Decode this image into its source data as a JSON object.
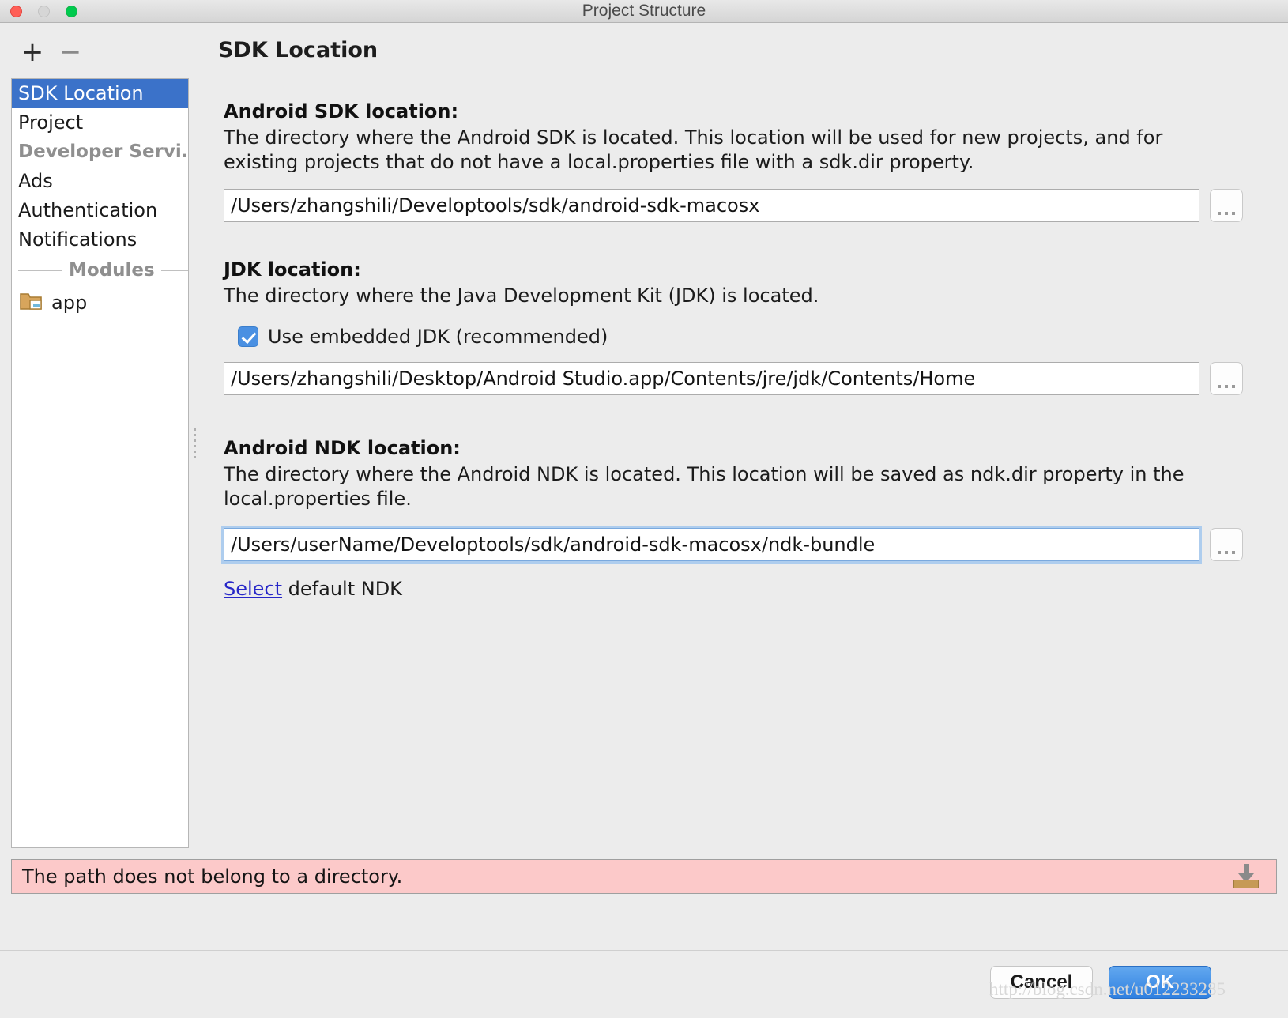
{
  "window": {
    "title": "Project Structure",
    "traffic_lights": [
      "close",
      "minimize",
      "maximize"
    ]
  },
  "left_toolbar": {
    "add_label": "+",
    "remove_label": "−"
  },
  "sidebar": {
    "items": [
      {
        "label": "SDK Location",
        "selected": true,
        "kind": "item"
      },
      {
        "label": "Project",
        "selected": false,
        "kind": "item"
      },
      {
        "label": "Developer Servi…",
        "selected": false,
        "kind": "group-head"
      },
      {
        "label": "Ads",
        "selected": false,
        "kind": "item"
      },
      {
        "label": "Authentication",
        "selected": false,
        "kind": "item"
      },
      {
        "label": "Notifications",
        "selected": false,
        "kind": "item"
      }
    ],
    "modules_separator_label": "Modules",
    "modules": [
      {
        "label": "app",
        "icon": "module-folder-icon"
      }
    ]
  },
  "main": {
    "page_title": "SDK Location",
    "sections": [
      {
        "title": "Android SDK location:",
        "description": "The directory where the Android SDK is located. This location will be used for new projects, and for existing projects that do not have a local.properties file with a sdk.dir property.",
        "field_value": "/Users/zhangshili/Developtools/sdk/android-sdk-macosx",
        "field_placeholder": "",
        "browse_label": "..."
      },
      {
        "title": "JDK location:",
        "description": "The directory where the Java Development Kit (JDK) is located.",
        "checkbox_label": "Use embedded JDK (recommended)",
        "checkbox_checked": true,
        "field_value": "/Users/zhangshili/Desktop/Android Studio.app/Contents/jre/jdk/Contents/Home",
        "field_placeholder": "",
        "browse_label": "..."
      },
      {
        "title": "Android NDK location:",
        "description": "The directory where the Android NDK is located. This location will be saved as ndk.dir property in the local.properties file.",
        "field_value": "/Users/userName/Developtools/sdk/android-sdk-macosx/ndk-bundle",
        "field_placeholder": "",
        "browse_label": "...",
        "link_text": "Select",
        "link_suffix": " default NDK"
      }
    ]
  },
  "status": {
    "error_message": "The path does not belong to a directory.",
    "error_bg": "#fcc9c9",
    "icon": "import-tray-icon"
  },
  "footer": {
    "cancel_label": "Cancel",
    "ok_label": "OK",
    "ok_accent": "#2f80e0"
  },
  "watermark": {
    "text": "http://blog.csdn.net/u012233285"
  }
}
